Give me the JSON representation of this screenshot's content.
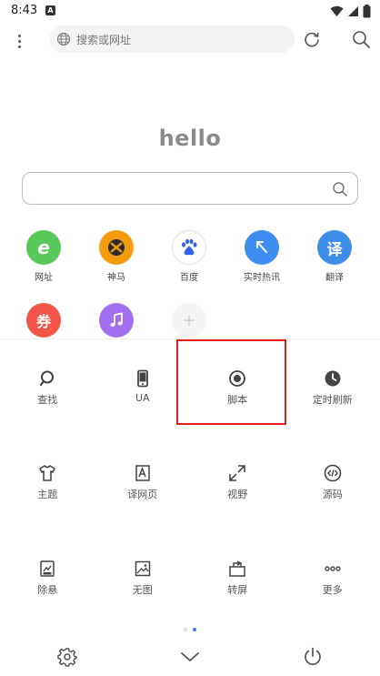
{
  "status": {
    "time": "8:43",
    "notif_letter": "A"
  },
  "topbar": {
    "url_placeholder": "搜索或网址"
  },
  "home": {
    "title": "hello"
  },
  "quick_links": [
    {
      "label": "网址",
      "glyph": "e",
      "color": "#58c858",
      "icon": "ie-e-icon"
    },
    {
      "label": "神马",
      "glyph": "",
      "color": "#f59c0c",
      "icon": "xbox-icon"
    },
    {
      "label": "百度",
      "glyph": "",
      "color": "#ffffff",
      "icon": "baidu-paw-icon"
    },
    {
      "label": "实时热讯",
      "glyph": "",
      "color": "#3d8ef0",
      "icon": "arrow-icon"
    },
    {
      "label": "翻译",
      "glyph": "译",
      "color": "#3e8de8",
      "icon": "translate-icon"
    },
    {
      "label": "",
      "glyph": "券",
      "color": "#f25545",
      "icon": "coupon-icon"
    },
    {
      "label": "",
      "glyph": "",
      "color": "#a070f0",
      "icon": "music-note-icon"
    },
    {
      "label": "",
      "glyph": "+",
      "color": "#f2f2f2",
      "icon": "add-icon"
    }
  ],
  "tools": [
    {
      "label": "查找",
      "icon": "find-icon"
    },
    {
      "label": "UA",
      "icon": "phone-icon"
    },
    {
      "label": "脚本",
      "icon": "script-record-icon"
    },
    {
      "label": "定时刷新",
      "icon": "clock-icon"
    },
    {
      "label": "主题",
      "icon": "tshirt-icon"
    },
    {
      "label": "译网页",
      "icon": "translate-page-icon"
    },
    {
      "label": "视野",
      "icon": "expand-icon"
    },
    {
      "label": "源码",
      "icon": "source-code-icon"
    },
    {
      "label": "除悬",
      "icon": "remove-float-icon"
    },
    {
      "label": "无图",
      "icon": "no-image-icon"
    },
    {
      "label": "转屏",
      "icon": "rotate-screen-icon"
    },
    {
      "label": "更多",
      "icon": "more-icon"
    }
  ],
  "colors": {
    "highlight": "#e81e1e",
    "active_dot": "#3e7be8",
    "inactive_dot": "#dddddd"
  }
}
